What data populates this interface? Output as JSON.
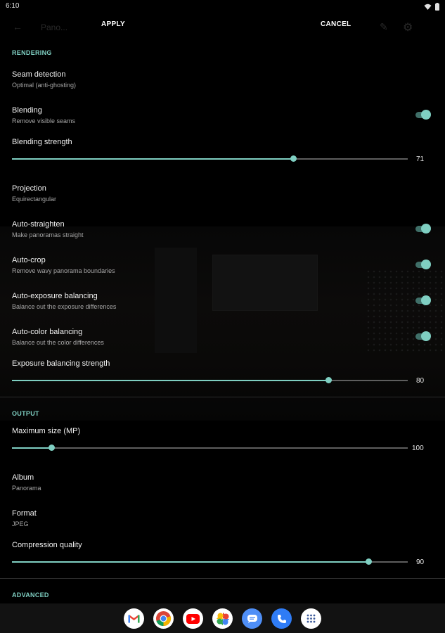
{
  "status": {
    "time": "6:10"
  },
  "toolbar": {
    "apply_label": "APPLY",
    "cancel_label": "CANCEL",
    "ghost_title": "Pano..."
  },
  "rendering": {
    "header": "RENDERING",
    "seam_detection": {
      "title": "Seam detection",
      "summary": "Optimal (anti-ghosting)"
    },
    "blending": {
      "title": "Blending",
      "summary": "Remove visible seams",
      "enabled": true
    },
    "blending_strength": {
      "title": "Blending strength",
      "value": 71,
      "display": "71",
      "max": 100
    },
    "projection": {
      "title": "Projection",
      "summary": "Equirectangular"
    },
    "auto_straighten": {
      "title": "Auto-straighten",
      "summary": "Make panoramas straight",
      "enabled": true
    },
    "auto_crop": {
      "title": "Auto-crop",
      "summary": "Remove wavy panorama boundaries",
      "enabled": true
    },
    "auto_exposure": {
      "title": "Auto-exposure balancing",
      "summary": "Balance out the exposure differences",
      "enabled": true
    },
    "auto_color": {
      "title": "Auto-color balancing",
      "summary": "Balance out the color differences",
      "enabled": true
    },
    "exposure_strength": {
      "title": "Exposure balancing strength",
      "value": 80,
      "display": "80",
      "max": 100
    }
  },
  "output": {
    "header": "OUTPUT",
    "max_size": {
      "title": "Maximum size (MP)",
      "value": 100,
      "display": "100",
      "fraction": 0.1
    },
    "album": {
      "title": "Album",
      "summary": "Panorama"
    },
    "format": {
      "title": "Format",
      "summary": "JPEG"
    },
    "compression": {
      "title": "Compression quality",
      "value": 90,
      "display": "90",
      "max": 100
    }
  },
  "advanced": {
    "header": "ADVANCED"
  },
  "dock": {
    "apps": [
      "gmail-icon",
      "chrome-icon",
      "youtube-icon",
      "photos-icon",
      "messages-icon",
      "phone-icon",
      "app-drawer-icon"
    ]
  },
  "colors": {
    "accent": "#7fcfc2",
    "track": "#3f6f68",
    "background": "#000000"
  }
}
